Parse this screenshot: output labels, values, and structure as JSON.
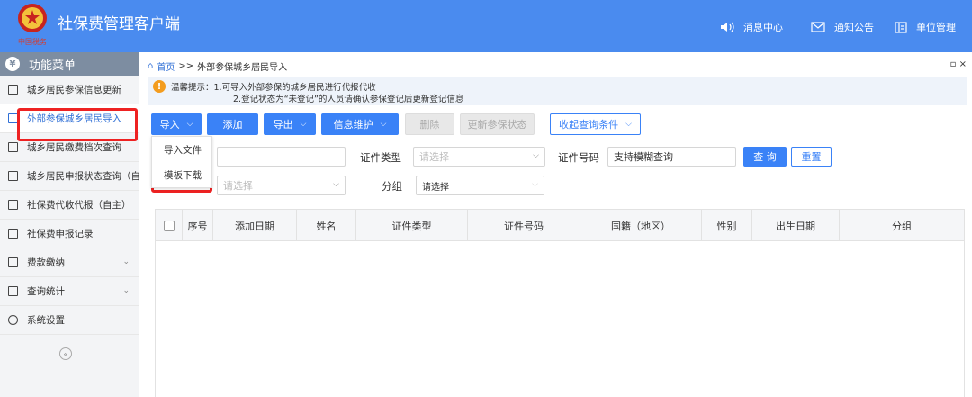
{
  "app": {
    "title": "社保费管理客户端",
    "logo_text": "中国税务"
  },
  "header_nav": [
    {
      "icon": "speaker-icon",
      "label": "消息中心"
    },
    {
      "icon": "mail-icon",
      "label": "通知公告"
    },
    {
      "icon": "building-icon",
      "label": "单位管理"
    }
  ],
  "sidebar": {
    "title": "功能菜单",
    "items": [
      {
        "label": "城乡居民参保信息更新"
      },
      {
        "label": "外部参保城乡居民导入"
      },
      {
        "label": "城乡居民缴费档次查询"
      },
      {
        "label": "城乡居民申报状态查询（自主）"
      },
      {
        "label": "社保费代收代报（自主）"
      },
      {
        "label": "社保费申报记录"
      },
      {
        "label": "费款缴纳"
      },
      {
        "label": "查询统计"
      },
      {
        "label": "系统设置"
      }
    ],
    "collapse": "«"
  },
  "breadcrumb": {
    "home": "首页",
    "sep": ">>",
    "current": "外部参保城乡居民导入"
  },
  "window_controls": "▫ ×",
  "notice": {
    "line1": "温馨提示：1.可导入外部参保的城乡居民进行代报代收",
    "line2": "2.登记状态为“未登记”的人员请确认参保登记后更新登记信息"
  },
  "toolbar": {
    "import": "导入",
    "add": "添加",
    "export": "导出",
    "info_maintain": "信息维护",
    "delete": "删除",
    "update_status": "更新参保状态",
    "collapse_conditions": "收起查询条件"
  },
  "import_menu": {
    "import_file": "导入文件",
    "template_download": "模板下载"
  },
  "filters": {
    "id_type_label": "证件类型",
    "id_type_placeholder": "请选择",
    "id_number_label": "证件号码",
    "id_number_value": "支持模糊查询",
    "row2_placeholder": "请选择",
    "group_label": "分组",
    "group_value": "请选择",
    "query": "查 询",
    "reset": "重置"
  },
  "table": {
    "columns": [
      "序号",
      "添加日期",
      "姓名",
      "证件类型",
      "证件号码",
      "国籍（地区）",
      "性别",
      "出生日期",
      "分组"
    ]
  },
  "colors": {
    "header_bg": "#4a8bef",
    "accent": "#3a82f7",
    "highlight": "#ee2222"
  }
}
